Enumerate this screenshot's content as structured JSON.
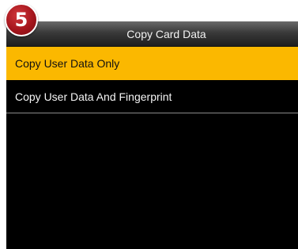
{
  "step_badge": "5",
  "title": "Copy Card Data",
  "menu": [
    {
      "label": "Copy User Data Only",
      "selected": true
    },
    {
      "label": "Copy User Data And Fingerprint",
      "selected": false
    }
  ],
  "colors": {
    "background": "#000000",
    "highlight": "#fbb800",
    "badge": "#a5161d"
  }
}
